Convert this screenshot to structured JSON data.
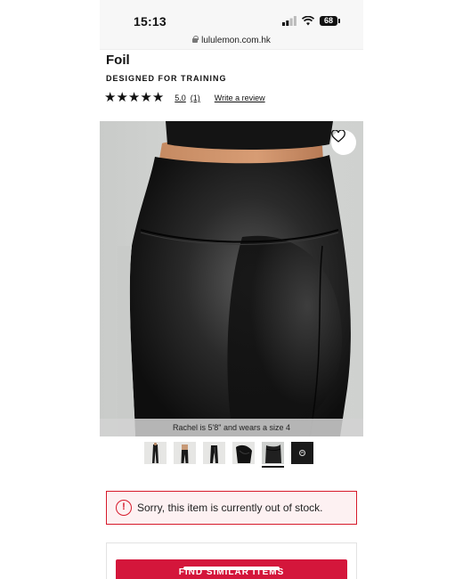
{
  "status_bar": {
    "time": "15:13",
    "battery": "68"
  },
  "browser": {
    "url": "lululemon.com.hk"
  },
  "product": {
    "name": "Foil",
    "subtitle": "DESIGNED FOR TRAINING",
    "rating": "5.0",
    "review_count": "(1)",
    "write_review": "Write a review",
    "stars": 5
  },
  "gallery": {
    "caption": "Rachel is 5'8\" and wears a size 4",
    "thumbnail_count": 6,
    "active_thumbnail": 5
  },
  "alert": {
    "message": "Sorry, this item is currently out of stock."
  },
  "cta": {
    "label": "FIND SIMILAR ITEMS"
  },
  "colors": {
    "accent_red": "#d4163b",
    "alert_border": "#d61a2b",
    "alert_bg": "#fdf1f2"
  }
}
